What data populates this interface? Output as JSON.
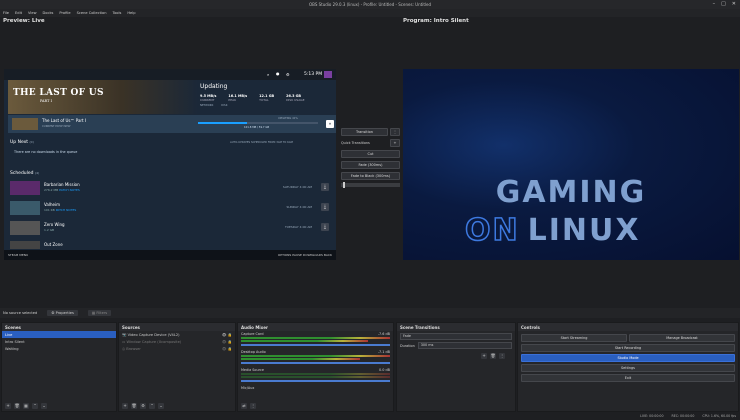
{
  "window": {
    "title": "OBS Studio 29.0.3 (linux) - Profile: Untitled - Scenes: Untitled",
    "min": "–",
    "max": "□",
    "close": "✕"
  },
  "menu": [
    "File",
    "Edit",
    "View",
    "Docks",
    "Profile",
    "Scene Collection",
    "Tools",
    "Help"
  ],
  "preview": {
    "label": "Preview: Live"
  },
  "program": {
    "label": "Program: Intro Silent",
    "line1": "GAMING",
    "on": "ON",
    "linux": "LINUX"
  },
  "steam": {
    "time": "5:13 PM",
    "hero_title": "THE LAST OF US",
    "hero_part": "PART I",
    "updating": "Updating",
    "stats": [
      {
        "v": "9.5 MB/s",
        "l": "CURRENT"
      },
      {
        "v": "16.1 MB/s",
        "l": "PEAK"
      },
      {
        "v": "12.1 GB",
        "l": "TOTAL"
      },
      {
        "v": "26.3 GB",
        "l": "DISK USAGE"
      }
    ],
    "net": "NETWORK",
    "disk": "DISK",
    "dl_game": "The Last of Us™ Part I",
    "dl_sub": "CURRENT PATCH  NEW",
    "dl_progress": "101.8 MB / 59.7 GB",
    "dl_status": "UPDATING 41%",
    "dl_fraction": 0.41,
    "up_next": "Up Next",
    "up_next_count": "(0)",
    "no_downloads": "There are no downloads in the queue",
    "auto_update": "AUTO-UPDATES SCHEDULED FROM 3AM TO 6AM",
    "scheduled": "Scheduled",
    "scheduled_count": "(4)",
    "games": [
      {
        "name": "Barbarian Mission",
        "size": "276.2 MB",
        "tag": "PATCH NOTES",
        "date": "SATURDAY 4:00 AM"
      },
      {
        "name": "Valheim",
        "size": "101 KB",
        "tag": "PATCH NOTES",
        "date": "SUNDAY 4:00 AM"
      },
      {
        "name": "Zero Wing",
        "size": "1.2 GB",
        "tag": "",
        "date": "TUESDAY 4:00 AM"
      },
      {
        "name": "Out Zone",
        "size": "",
        "tag": "",
        "date": ""
      }
    ],
    "bottom_left": "STEAM  MENU",
    "bottom_right": "OPTIONS   PAUSE DOWNLOADS   BACK"
  },
  "transitions": {
    "transition": "Transition",
    "quick": "Quick Transitions",
    "cut": "Cut",
    "fade": "Fade (300ms)",
    "fade_black": "Fade to Black (300ms)"
  },
  "source_bar": {
    "no_source": "No source selected",
    "properties": "Properties",
    "filters": "Filters"
  },
  "scenes": {
    "title": "Scenes",
    "items": [
      "Live",
      "Intro Silent",
      "Waiting"
    ]
  },
  "sources": {
    "title": "Sources",
    "items": [
      "Video Capture Device (V4L2)",
      "Window Capture (Xcomposite)",
      "Browser"
    ]
  },
  "mixer": {
    "title": "Audio Mixer",
    "channels": [
      {
        "name": "Capture Card",
        "db": "-7.6 dB"
      },
      {
        "name": "Desktop Audio",
        "db": "-7.1 dB"
      },
      {
        "name": "Media Source",
        "db": "0.0 dB"
      },
      {
        "name": "Mic/Aux",
        "db": ""
      }
    ]
  },
  "scene_trans": {
    "title": "Scene Transitions",
    "type": "Fade",
    "duration_label": "Duration",
    "duration": "300 ms"
  },
  "controls": {
    "title": "Controls",
    "start_streaming": "Start Streaming",
    "manage_broadcast": "Manage Broadcast",
    "start_recording": "Start Recording",
    "studio_mode": "Studio Mode",
    "settings": "Settings",
    "exit": "Exit"
  },
  "status": {
    "live": "LIVE: 00:00:00",
    "rec": "REC: 00:00:00",
    "cpu": "CPU: 1.6%, 60.00 fps"
  },
  "colors": {
    "accent": "#2a5fc0"
  }
}
